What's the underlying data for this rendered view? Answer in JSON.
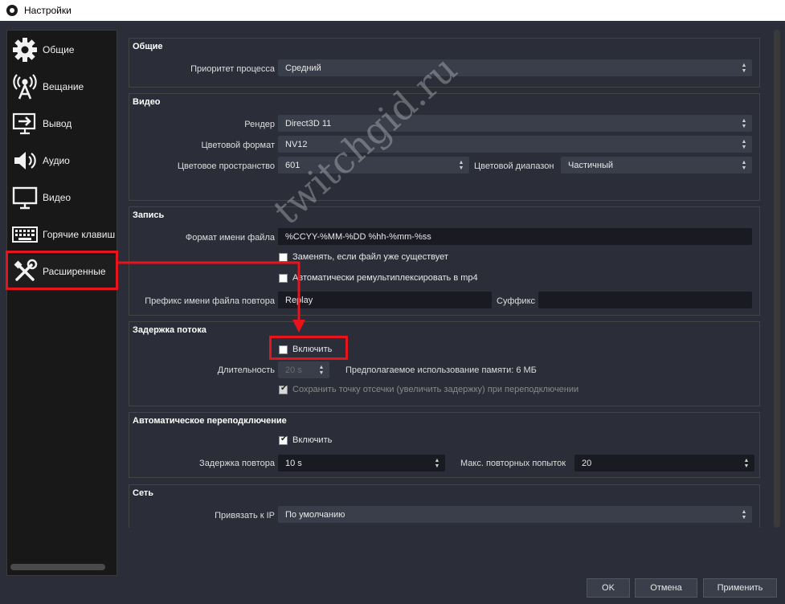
{
  "window": {
    "title": "Настройки"
  },
  "sidebar": {
    "items": [
      {
        "label": "Общие",
        "icon": "gear-icon"
      },
      {
        "label": "Вещание",
        "icon": "broadcast-icon"
      },
      {
        "label": "Вывод",
        "icon": "output-icon"
      },
      {
        "label": "Аудио",
        "icon": "speaker-icon"
      },
      {
        "label": "Видео",
        "icon": "monitor-icon"
      },
      {
        "label": "Горячие клавиш",
        "icon": "keyboard-icon"
      },
      {
        "label": "Расширенные",
        "icon": "tools-icon"
      }
    ],
    "active": "Расширенные"
  },
  "general": {
    "title": "Общие",
    "priority_label": "Приоритет процесса",
    "priority_value": "Средний"
  },
  "video": {
    "title": "Видео",
    "renderer_label": "Рендер",
    "renderer_value": "Direct3D 11",
    "color_format_label": "Цветовой формат",
    "color_format_value": "NV12",
    "color_space_label": "Цветовое пространство",
    "color_space_value": "601",
    "color_range_label": "Цветовой диапазон",
    "color_range_value": "Частичный"
  },
  "recording": {
    "title": "Запись",
    "filename_format_label": "Формат имени файла",
    "filename_format_value": "%CCYY-%MM-%DD %hh-%mm-%ss",
    "overwrite_label": "Заменять, если файл уже существует",
    "overwrite_checked": false,
    "remux_label": "Автоматически ремультиплексировать в mp4",
    "remux_checked": false,
    "replay_prefix_label": "Префикс имени файла повтора",
    "replay_prefix_value": "Replay",
    "suffix_label": "Суффикс",
    "suffix_value": ""
  },
  "stream_delay": {
    "title": "Задержка потока",
    "enable_label": "Включить",
    "enable_checked": false,
    "duration_label": "Длительность",
    "duration_value": "20 s",
    "memory_note": "Предполагаемое использование памяти: 6 МБ",
    "preserve_label": "Сохранить точку отсечки (увеличить задержку) при переподключении",
    "preserve_checked": true
  },
  "reconnect": {
    "title": "Автоматическое переподключение",
    "enable_label": "Включить",
    "enable_checked": true,
    "retry_delay_label": "Задержка повтора",
    "retry_delay_value": "10 s",
    "max_retries_label": "Макс. повторных попыток",
    "max_retries_value": "20"
  },
  "network": {
    "title": "Сеть",
    "bind_ip_label": "Привязать к IP",
    "bind_ip_value": "По умолчанию"
  },
  "buttons": {
    "ok": "OK",
    "cancel": "Отмена",
    "apply": "Применить"
  },
  "watermark": "twitchgid.ru",
  "colors": {
    "highlight": "#e8141c",
    "background": "#2b2e38",
    "sidebar": "#181818"
  }
}
